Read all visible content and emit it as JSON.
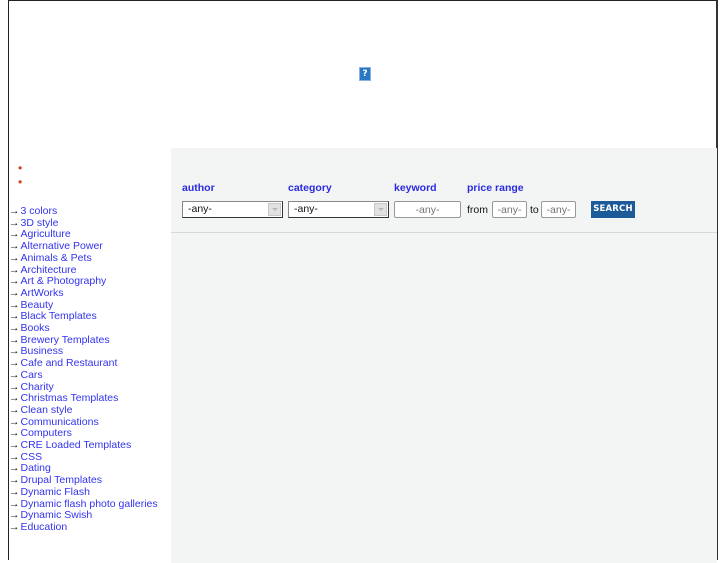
{
  "banner": {
    "broken_image_icon": "?"
  },
  "sidebar": {
    "bullets": [
      "•",
      "•"
    ],
    "arrow_glyph": "→",
    "categories": [
      "3 colors",
      "3D style",
      "Agriculture",
      "Alternative Power",
      "Animals & Pets",
      "Architecture",
      "Art & Photography",
      "ArtWorks",
      "Beauty",
      "Black Templates",
      "Books",
      "Brewery Templates",
      "Business",
      "Cafe and Restaurant",
      "Cars",
      "Charity",
      "Christmas Templates",
      "Clean style",
      "Communications",
      "Computers",
      "CRE Loaded Templates",
      "CSS",
      "Dating",
      "Drupal Templates",
      "Dynamic Flash",
      "Dynamic flash photo galleries",
      "Dynamic Swish",
      "Education"
    ]
  },
  "search": {
    "author_label": "author",
    "author_value": "-any-",
    "category_label": "category",
    "category_value": "-any-",
    "keyword_label": "keyword",
    "keyword_placeholder": "-any-",
    "price_label": "price range",
    "from_text": "from",
    "from_placeholder": "-any-",
    "to_text": "to",
    "to_placeholder": "-any-",
    "button_label": "SEARCH"
  },
  "colors": {
    "link": "#3333ee",
    "label": "#2a2ae0",
    "button": "#1d5a99",
    "panel_bg": "#f3f4f4",
    "bullet": "#cc4411"
  }
}
